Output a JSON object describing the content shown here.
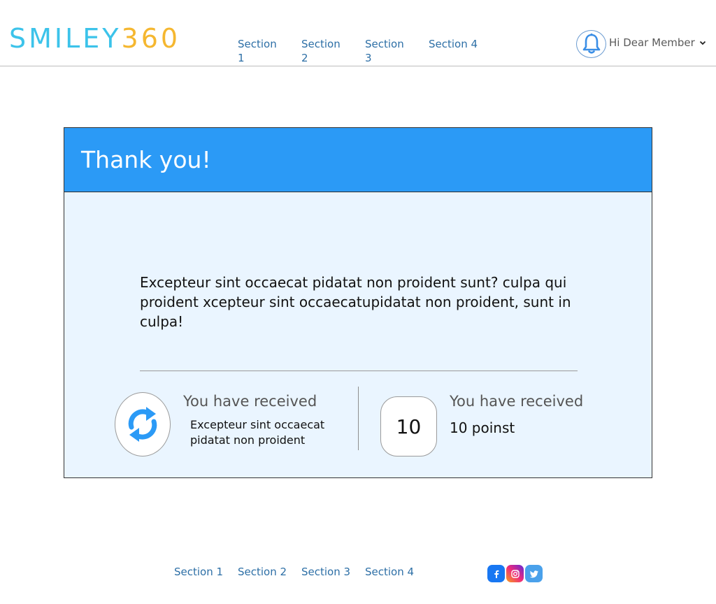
{
  "header": {
    "logo_part1": "SMILEY",
    "logo_part2": "360",
    "nav": [
      "Section 1",
      "Section 2",
      "Section 3",
      "Section 4"
    ],
    "member_label": "Hi Dear Member",
    "bell_icon": "bell-icon",
    "chevron_icon": "chevron-down-icon"
  },
  "card": {
    "title": "Thank you!",
    "message": "Excepteur sint occaecat pidatat non proident sunt? culpa qui proident xcepteur sint occaecatupidatat non proident, sunt in culpa!",
    "reward1": {
      "icon": "refresh-icon",
      "heading": "You have received",
      "description": "Excepteur sint occaecat pidatat non proident"
    },
    "reward2": {
      "points": "10",
      "heading": "You have received",
      "description": "10 poinst"
    }
  },
  "footer": {
    "nav": [
      "Section 1",
      "Section 2",
      "Section 3",
      "Section 4"
    ],
    "social": [
      "facebook-icon",
      "instagram-icon",
      "twitter-icon"
    ]
  },
  "colors": {
    "header_blue": "#2b9af6",
    "card_bg": "#eaf5ff",
    "logo_cyan": "#3cc3ea",
    "logo_orange": "#f5b730",
    "link_blue": "#2d6fa6"
  }
}
